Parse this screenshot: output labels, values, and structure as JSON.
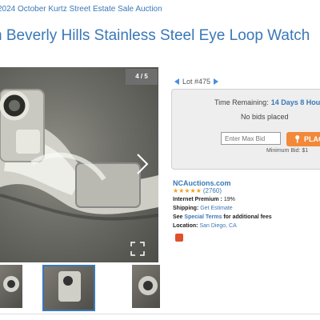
{
  "breadcrumb": "2024 October Kurtz Street Estate Sale Auction",
  "title": "n Beverly Hills Stainless Steel Eye Loop Watch",
  "gallery": {
    "counter": "4 / 5"
  },
  "lot": {
    "label": "Lot #475"
  },
  "bidding": {
    "time_label": "Time Remaining:",
    "time_value": "14 Days 8 Hou",
    "status": "No bids placed",
    "input_placeholder": "Enter Max Bid",
    "place_label": "PLAC",
    "min_bid": "Minimum Bid: $1"
  },
  "seller": {
    "name": "NCAuctions.com",
    "stars": "★★★★★",
    "rating_count": "(2760)",
    "premium_label": "Internet Premium :",
    "premium_value": "19%",
    "shipping_label": "Shipping:",
    "shipping_link": "Get Estimate",
    "terms_prefix": "See",
    "terms_link": "Special Terms",
    "terms_suffix": "for additional fees",
    "location_label": "Location:",
    "location_value": "San Diego, CA"
  },
  "colors": {
    "link": "#3a78b7",
    "accent": "#f2893a",
    "star": "#f0a020"
  }
}
